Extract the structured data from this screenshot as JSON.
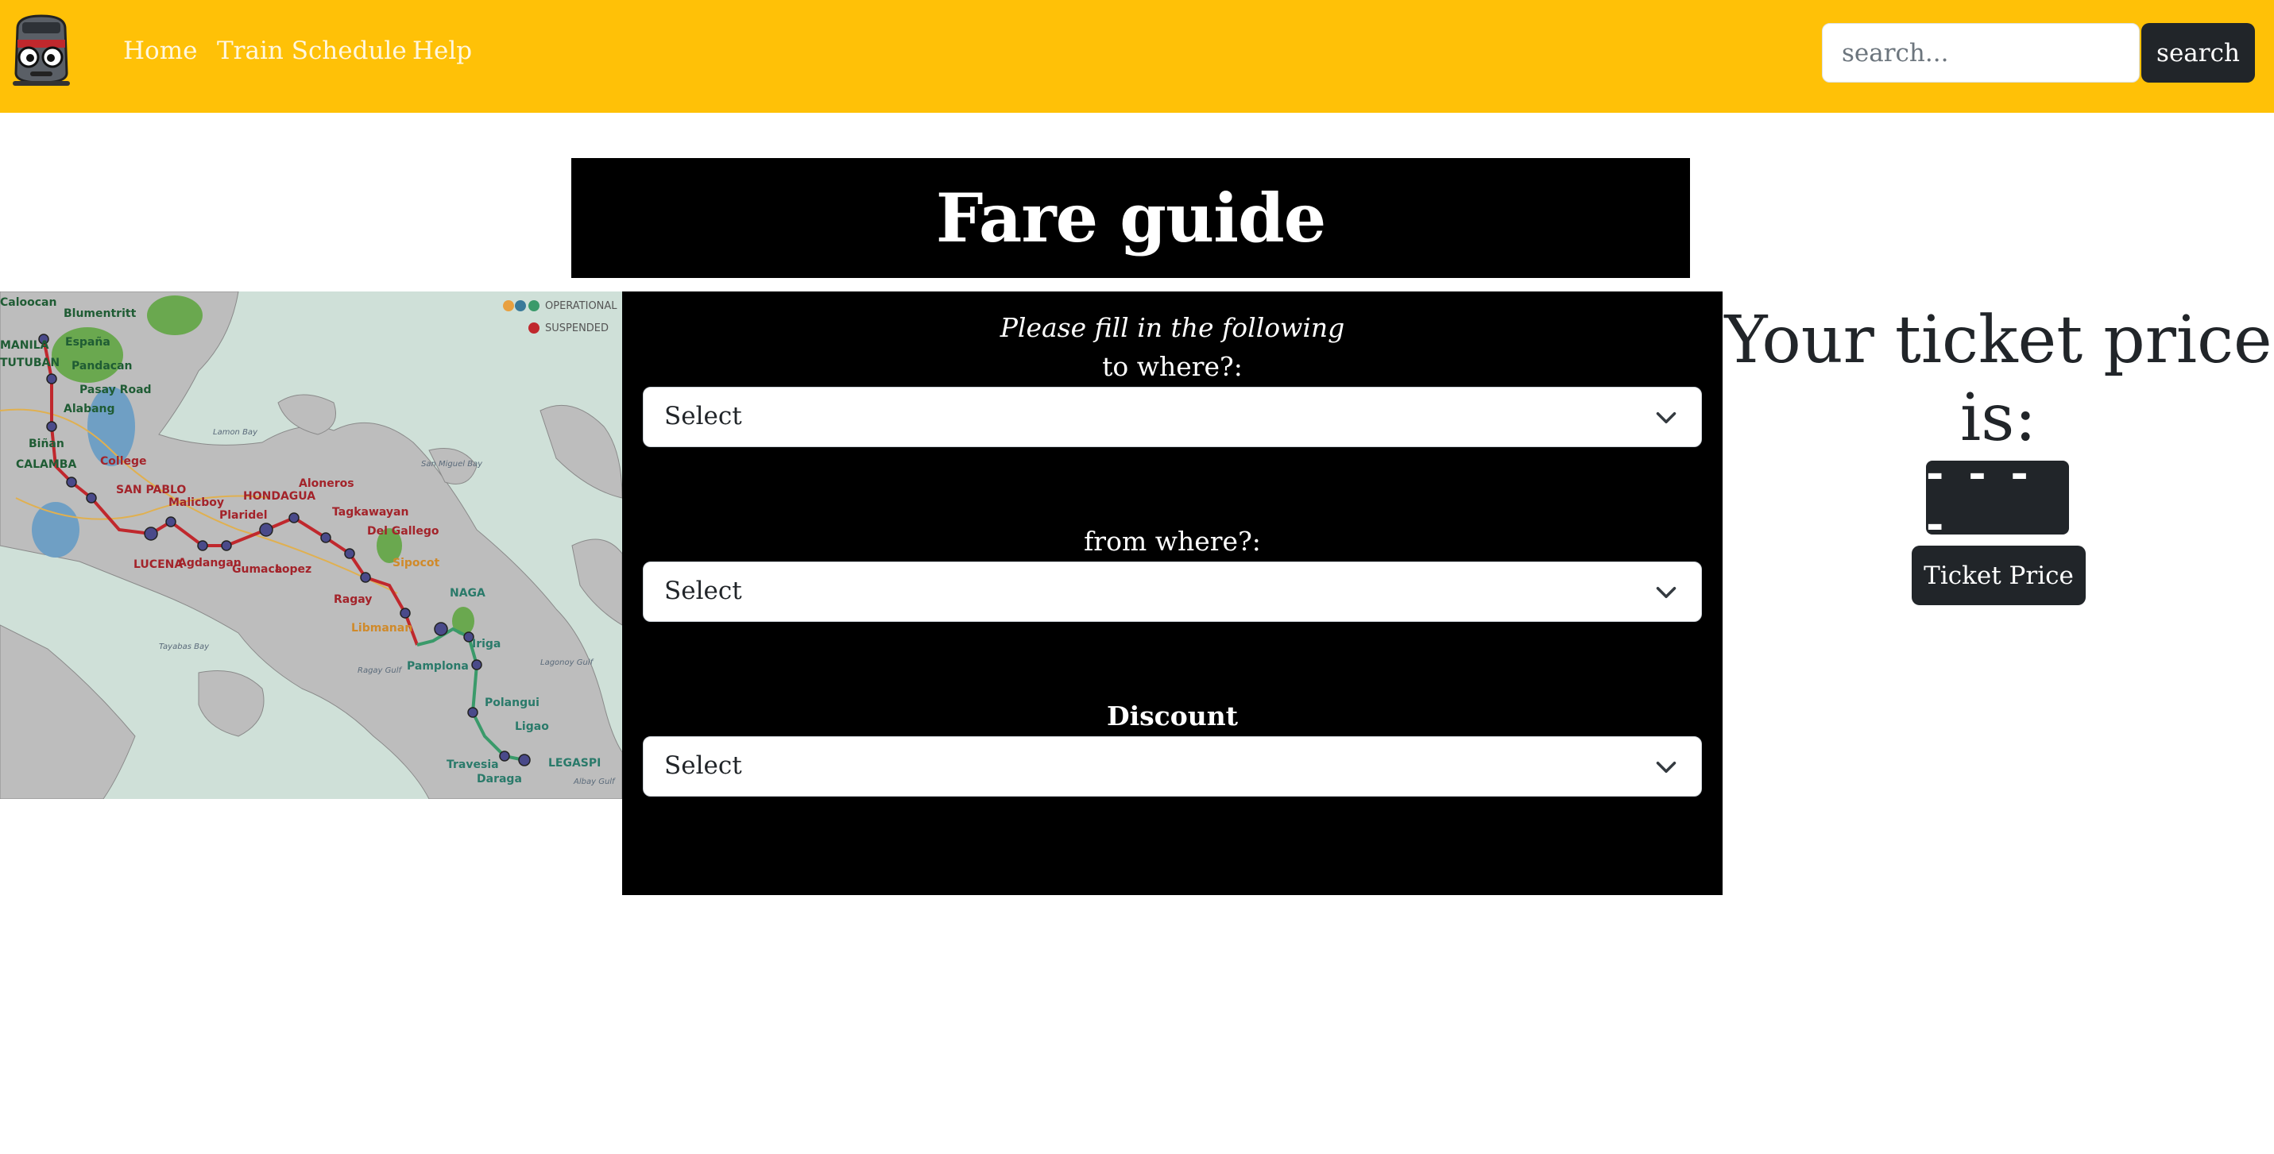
{
  "nav": {
    "links": [
      "Home",
      "Train Schedule",
      "Help"
    ],
    "search_placeholder": "search...",
    "search_button": "search"
  },
  "page": {
    "title": "Fare guide"
  },
  "map": {
    "legend": [
      "OPERATIONAL",
      "SUSPENDED"
    ],
    "stations": [
      "Caloocan",
      "Blumentritt",
      "MANILA",
      "TUTUBAN",
      "España",
      "Pandacan",
      "Pasay Road",
      "Alabang",
      "Biñan",
      "CALAMBA",
      "College",
      "SAN PABLO",
      "Malicboy",
      "Plaridel",
      "HONDAGUA",
      "Aloneros",
      "Tagkawayan",
      "Del Gallego",
      "LUCENA",
      "Agdangan",
      "Gumaca",
      "Lopez",
      "Ragay",
      "Sipocot",
      "Libmanan",
      "NAGA",
      "Pamplona",
      "Iriga",
      "Polangui",
      "Ligao",
      "Travesia",
      "LEGASPI",
      "Daraga"
    ],
    "water_labels": [
      "Lamon Bay",
      "Ragay Gulf",
      "Tayabas Bay",
      "San Miguel Bay",
      "Lagonoy Gulf",
      "Albay Gulf"
    ],
    "colors": {
      "route_red": "#c0282d",
      "route_green": "#3a9a6a",
      "land": "#bdbdbd",
      "sea": "#cfe0d8",
      "park": "#6aa84f",
      "lake": "#6f9fc4"
    }
  },
  "form": {
    "intro": "Please fill in the following",
    "to_label": "to where?:",
    "from_label": "from where?:",
    "discount_label": "Discount",
    "select_placeholder": "Select"
  },
  "result": {
    "heading": "Your ticket price is:",
    "price_display": "- - - -",
    "button": "Ticket Price"
  },
  "colors": {
    "navbar": "#ffc107",
    "dark": "#212529",
    "panel": "#000000"
  }
}
